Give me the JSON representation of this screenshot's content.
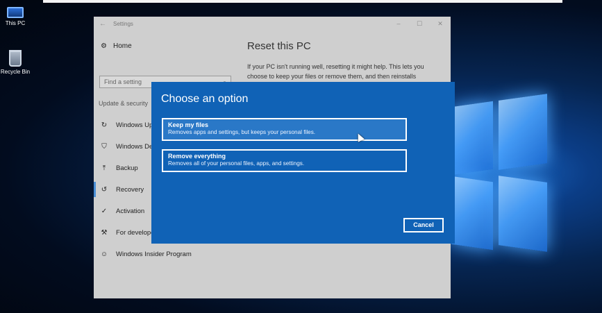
{
  "desktop": {
    "icons": [
      {
        "label": "This PC",
        "icon": "computer-icon"
      },
      {
        "label": "Recycle Bin",
        "icon": "recycle-bin-icon"
      }
    ]
  },
  "settings": {
    "title": "Settings",
    "home": "Home",
    "search_placeholder": "Find a setting",
    "section": "Update & security",
    "nav": [
      {
        "label": "Windows Update",
        "icon": "refresh-icon"
      },
      {
        "label": "Windows Defender",
        "icon": "shield-icon"
      },
      {
        "label": "Backup",
        "icon": "backup-arrow-icon"
      },
      {
        "label": "Recovery",
        "icon": "recovery-icon",
        "active": true
      },
      {
        "label": "Activation",
        "icon": "check-circle-icon"
      },
      {
        "label": "For developers",
        "icon": "developer-icon"
      },
      {
        "label": "Windows Insider Program",
        "icon": "insider-icon"
      }
    ],
    "main": {
      "heading": "Reset this PC",
      "body": "If your PC isn't running well, resetting it might help. This lets you choose to keep your files or remove them, and then reinstalls"
    }
  },
  "dialog": {
    "title": "Choose an option",
    "options": [
      {
        "title": "Keep my files",
        "desc": "Removes apps and settings, but keeps your personal files."
      },
      {
        "title": "Remove everything",
        "desc": "Removes all of your personal files, apps, and settings."
      }
    ],
    "cancel": "Cancel"
  },
  "colors": {
    "dialog_bg": "#1062b6",
    "accent": "#4a8fd6"
  }
}
